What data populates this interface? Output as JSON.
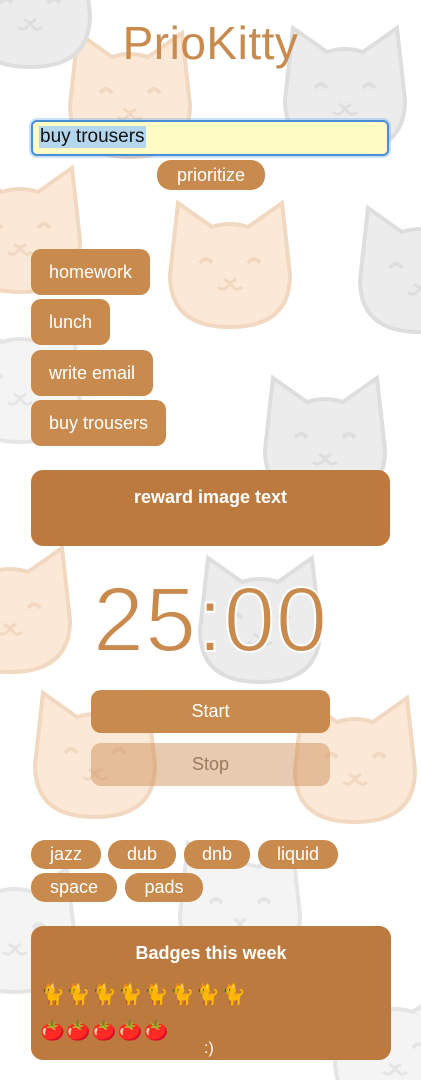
{
  "app": {
    "title": "PrioKitty"
  },
  "task_input": {
    "value": "buy trousers"
  },
  "prioritize_label": "prioritize",
  "tasks": [
    "homework",
    "lunch",
    "write email",
    "buy trousers"
  ],
  "reward": {
    "text": "reward image text"
  },
  "timer": {
    "display": "25:00"
  },
  "controls": {
    "start_label": "Start",
    "stop_label": "Stop"
  },
  "genres": [
    "jazz",
    "dub",
    "dnb",
    "liquid",
    "space",
    "pads"
  ],
  "badges": {
    "title": "Badges this week",
    "cat_row": "🐈🐈🐈🐈🐈🐈🐈🐈",
    "tomato_row": "🍅🍅🍅🍅🍅",
    "smile": ":)"
  },
  "colors": {
    "accent": "#c98a4e",
    "panel": "#bd7a3e",
    "input_bg": "#fffcc6",
    "focus": "#4a8fd6"
  }
}
